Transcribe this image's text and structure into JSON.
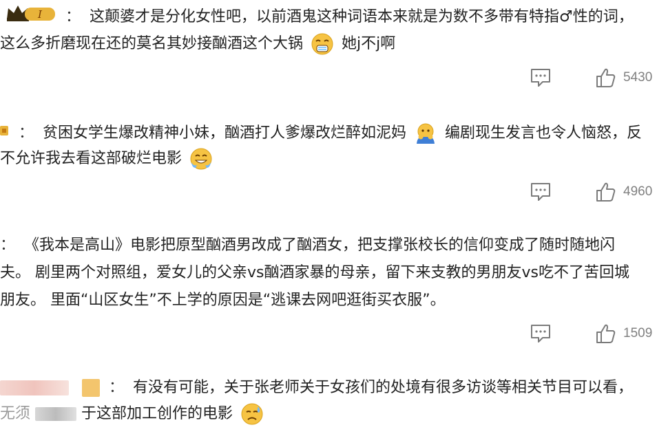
{
  "comments": [
    {
      "line1_text": "这颠婆才是分化女性吧，以前酒鬼这种词语本来就是为数不多带有特指♂性的词，",
      "line2_text": "这么多折磨现在还的莫名其妙接酗酒这个大锅",
      "line2_tail": "她j不j啊",
      "emoji": "smirk-emoji",
      "likes": "5430"
    },
    {
      "line1_text": "贫困女学生爆改精神小妹，酗酒打人爹爆改烂醉如泥妈",
      "line1_tail": "编剧现生发言也令人恼怒，反",
      "line2_text": "不允许我去看这部破烂电影",
      "emoji_mid": "facepalm-emoji",
      "emoji_end": "sweat-smile-emoji",
      "likes": "4960"
    },
    {
      "line1_text": "《我本是高山》电影把原型酗酒男改成了酗酒女，把支撑张校长的信仰变成了随时随地闪",
      "line2_text": "夫。 剧里两个对照组，爱女儿的父亲vs酗酒家暴的母亲，留下来支教的男朋友vs吃不了苦回城",
      "line3_text": "朋友。 里面“山区女生”不上学的原因是“逃课去网吧逛街买衣服”。",
      "likes": "1509"
    },
    {
      "line1_text": "有没有可能，关于张老师关于女孩们的处境有很多访谈等相关节目可以看，",
      "line2_prefix": "无须",
      "line2_text": "于这部加工创作的电影",
      "emoji": "sad-sweat-emoji"
    }
  ],
  "colors": {
    "text": "#222222",
    "meta": "#808080",
    "icon": "#7a7a7a",
    "badge_gold": "#e8b33a"
  }
}
